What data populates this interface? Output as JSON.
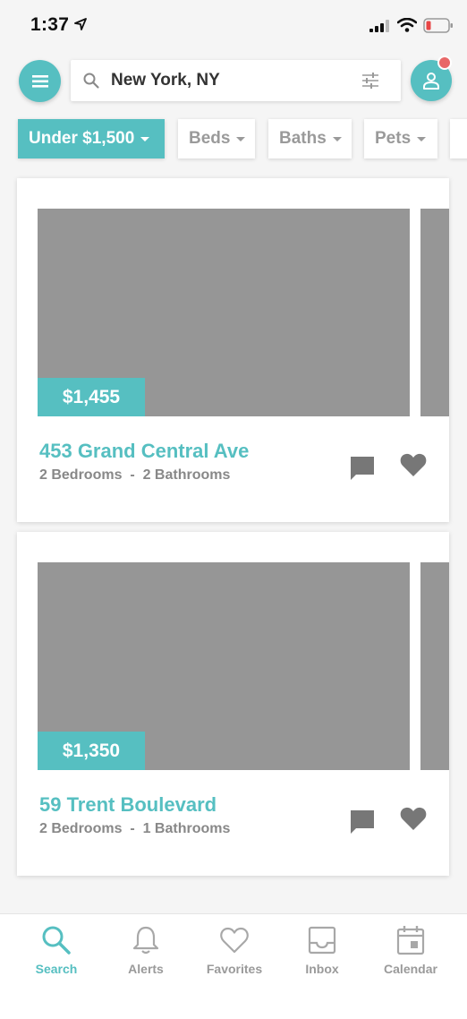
{
  "status_bar": {
    "time": "1:37"
  },
  "search": {
    "value": "New York, NY"
  },
  "filters": [
    {
      "label": "Under $1,500",
      "active": true
    },
    {
      "label": "Beds",
      "active": false
    },
    {
      "label": "Baths",
      "active": false
    },
    {
      "label": "Pets",
      "active": false
    }
  ],
  "listings": [
    {
      "price": "$1,455",
      "address": "453 Grand Central Ave",
      "bedrooms": "2 Bedrooms",
      "separator": "-",
      "bathrooms": "2 Bathrooms"
    },
    {
      "price": "$1,350",
      "address": "59 Trent Boulevard",
      "bedrooms": "2 Bedrooms",
      "separator": "-",
      "bathrooms": "1 Bathrooms"
    }
  ],
  "tabs": [
    {
      "label": "Search",
      "icon": "search-icon",
      "active": true
    },
    {
      "label": "Alerts",
      "icon": "bell-icon",
      "active": false
    },
    {
      "label": "Favorites",
      "icon": "heart-outline-icon",
      "active": false
    },
    {
      "label": "Inbox",
      "icon": "inbox-icon",
      "active": false
    },
    {
      "label": "Calendar",
      "icon": "calendar-icon",
      "active": false
    }
  ],
  "colors": {
    "accent": "#56bfc1",
    "notification": "#e86868",
    "placeholder_photo": "#969696",
    "inactive": "#9a9a9a"
  }
}
